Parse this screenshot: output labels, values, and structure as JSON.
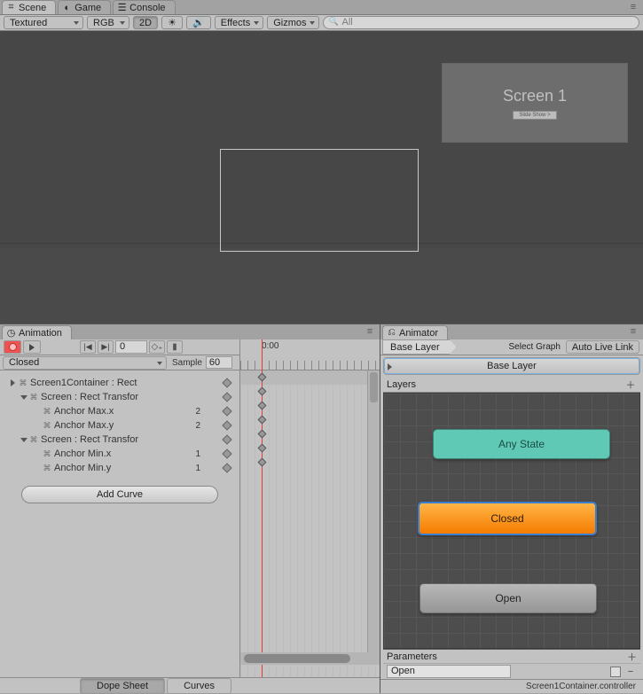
{
  "tabs": {
    "scene": "Scene",
    "game": "Game",
    "console": "Console"
  },
  "sceneToolbar": {
    "renderMode": "Textured",
    "channel": "RGB",
    "dim": "2D",
    "effects": "Effects",
    "gizmos": "Gizmos",
    "searchPlaceholder": "All"
  },
  "sceneView": {
    "screen1Title": "Screen 1",
    "screen1Btn": "Slide Show >"
  },
  "animation": {
    "tab": "Animation",
    "frame": "0",
    "clip": "Closed",
    "sampleLabel": "Sample",
    "sampleValue": "60",
    "rulerLabel": "0:00",
    "properties": [
      {
        "label": "Screen1Container : Rect",
        "indent": 0,
        "fold": "right",
        "hasKey": true
      },
      {
        "label": "Screen : Rect Transfor",
        "indent": 1,
        "fold": "down",
        "hasKey": true
      },
      {
        "label": "Anchor Max.x",
        "indent": 2,
        "value": "2",
        "hasKey": true
      },
      {
        "label": "Anchor Max.y",
        "indent": 2,
        "value": "2",
        "hasKey": true
      },
      {
        "label": "Screen : Rect Transfor",
        "indent": 1,
        "fold": "down",
        "hasKey": true
      },
      {
        "label": "Anchor Min.x",
        "indent": 2,
        "value": "1",
        "hasKey": true
      },
      {
        "label": "Anchor Min.y",
        "indent": 2,
        "value": "1",
        "hasKey": true
      }
    ],
    "addCurve": "Add Curve",
    "dopeSheet": "Dope Sheet",
    "curves": "Curves"
  },
  "animator": {
    "tab": "Animator",
    "breadcrumb": "Base Layer",
    "selectGraph": "Select Graph",
    "autoLiveLink": "Auto Live Link",
    "baseLayerBtn": "Base Layer",
    "layersLabel": "Layers",
    "states": {
      "any": "Any State",
      "closed": "Closed",
      "open": "Open"
    },
    "paramsLabel": "Parameters",
    "paramName": "Open",
    "status": "Screen1Container.controller"
  }
}
